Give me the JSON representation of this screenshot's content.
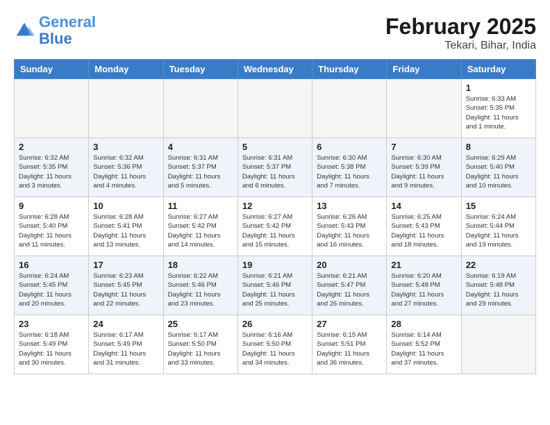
{
  "logo": {
    "general": "General",
    "blue": "Blue"
  },
  "title": {
    "month_year": "February 2025",
    "location": "Tekari, Bihar, India"
  },
  "weekdays": [
    "Sunday",
    "Monday",
    "Tuesday",
    "Wednesday",
    "Thursday",
    "Friday",
    "Saturday"
  ],
  "weeks": [
    [
      {
        "day": "",
        "info": ""
      },
      {
        "day": "",
        "info": ""
      },
      {
        "day": "",
        "info": ""
      },
      {
        "day": "",
        "info": ""
      },
      {
        "day": "",
        "info": ""
      },
      {
        "day": "",
        "info": ""
      },
      {
        "day": "1",
        "info": "Sunrise: 6:33 AM\nSunset: 5:35 PM\nDaylight: 11 hours and 1 minute."
      }
    ],
    [
      {
        "day": "2",
        "info": "Sunrise: 6:32 AM\nSunset: 5:35 PM\nDaylight: 11 hours and 3 minutes."
      },
      {
        "day": "3",
        "info": "Sunrise: 6:32 AM\nSunset: 5:36 PM\nDaylight: 11 hours and 4 minutes."
      },
      {
        "day": "4",
        "info": "Sunrise: 6:31 AM\nSunset: 5:37 PM\nDaylight: 11 hours and 5 minutes."
      },
      {
        "day": "5",
        "info": "Sunrise: 6:31 AM\nSunset: 5:37 PM\nDaylight: 11 hours and 6 minutes."
      },
      {
        "day": "6",
        "info": "Sunrise: 6:30 AM\nSunset: 5:38 PM\nDaylight: 11 hours and 7 minutes."
      },
      {
        "day": "7",
        "info": "Sunrise: 6:30 AM\nSunset: 5:39 PM\nDaylight: 11 hours and 9 minutes."
      },
      {
        "day": "8",
        "info": "Sunrise: 6:29 AM\nSunset: 5:40 PM\nDaylight: 11 hours and 10 minutes."
      }
    ],
    [
      {
        "day": "9",
        "info": "Sunrise: 6:28 AM\nSunset: 5:40 PM\nDaylight: 11 hours and 11 minutes."
      },
      {
        "day": "10",
        "info": "Sunrise: 6:28 AM\nSunset: 5:41 PM\nDaylight: 11 hours and 13 minutes."
      },
      {
        "day": "11",
        "info": "Sunrise: 6:27 AM\nSunset: 5:42 PM\nDaylight: 11 hours and 14 minutes."
      },
      {
        "day": "12",
        "info": "Sunrise: 6:27 AM\nSunset: 5:42 PM\nDaylight: 11 hours and 15 minutes."
      },
      {
        "day": "13",
        "info": "Sunrise: 6:26 AM\nSunset: 5:43 PM\nDaylight: 11 hours and 16 minutes."
      },
      {
        "day": "14",
        "info": "Sunrise: 6:25 AM\nSunset: 5:43 PM\nDaylight: 11 hours and 18 minutes."
      },
      {
        "day": "15",
        "info": "Sunrise: 6:24 AM\nSunset: 5:44 PM\nDaylight: 11 hours and 19 minutes."
      }
    ],
    [
      {
        "day": "16",
        "info": "Sunrise: 6:24 AM\nSunset: 5:45 PM\nDaylight: 11 hours and 20 minutes."
      },
      {
        "day": "17",
        "info": "Sunrise: 6:23 AM\nSunset: 5:45 PM\nDaylight: 11 hours and 22 minutes."
      },
      {
        "day": "18",
        "info": "Sunrise: 6:22 AM\nSunset: 5:46 PM\nDaylight: 11 hours and 23 minutes."
      },
      {
        "day": "19",
        "info": "Sunrise: 6:21 AM\nSunset: 5:46 PM\nDaylight: 11 hours and 25 minutes."
      },
      {
        "day": "20",
        "info": "Sunrise: 6:21 AM\nSunset: 5:47 PM\nDaylight: 11 hours and 26 minutes."
      },
      {
        "day": "21",
        "info": "Sunrise: 6:20 AM\nSunset: 5:48 PM\nDaylight: 11 hours and 27 minutes."
      },
      {
        "day": "22",
        "info": "Sunrise: 6:19 AM\nSunset: 5:48 PM\nDaylight: 11 hours and 29 minutes."
      }
    ],
    [
      {
        "day": "23",
        "info": "Sunrise: 6:18 AM\nSunset: 5:49 PM\nDaylight: 11 hours and 30 minutes."
      },
      {
        "day": "24",
        "info": "Sunrise: 6:17 AM\nSunset: 5:49 PM\nDaylight: 11 hours and 31 minutes."
      },
      {
        "day": "25",
        "info": "Sunrise: 6:17 AM\nSunset: 5:50 PM\nDaylight: 11 hours and 33 minutes."
      },
      {
        "day": "26",
        "info": "Sunrise: 6:16 AM\nSunset: 5:50 PM\nDaylight: 11 hours and 34 minutes."
      },
      {
        "day": "27",
        "info": "Sunrise: 6:15 AM\nSunset: 5:51 PM\nDaylight: 11 hours and 36 minutes."
      },
      {
        "day": "28",
        "info": "Sunrise: 6:14 AM\nSunset: 5:52 PM\nDaylight: 11 hours and 37 minutes."
      },
      {
        "day": "",
        "info": ""
      }
    ]
  ]
}
